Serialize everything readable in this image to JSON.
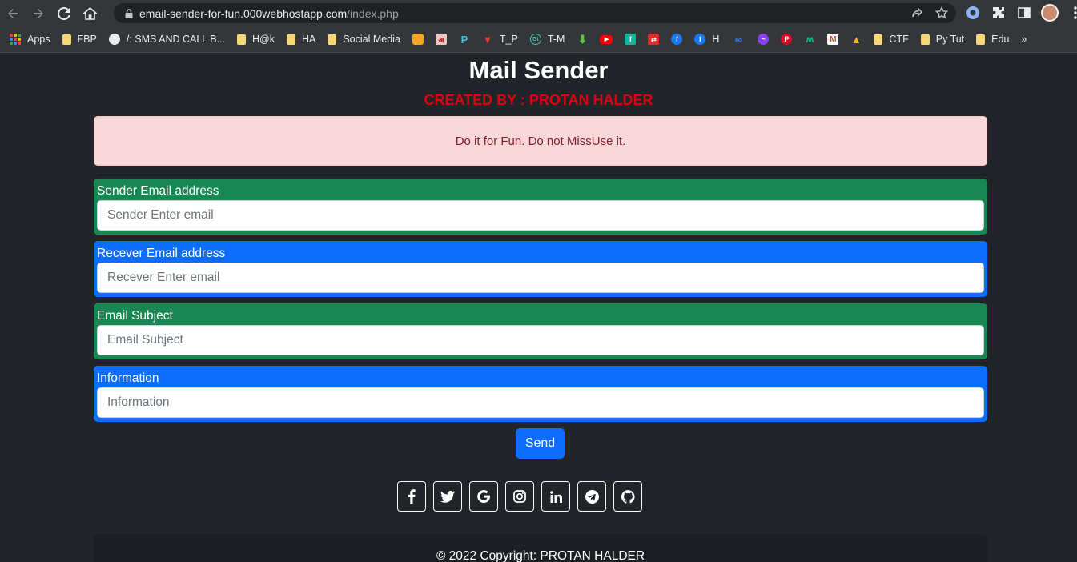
{
  "browser": {
    "url_host": "email-sender-for-fun.000webhostapp.com",
    "url_path": "/index.php",
    "icons": [
      "back-icon",
      "forward-icon",
      "reload-icon",
      "home-icon",
      "lock-icon",
      "share-icon",
      "star-icon",
      "extension-icon",
      "puzzle-icon",
      "sidebar-icon",
      "menu-icon"
    ]
  },
  "bookmarks": {
    "items": [
      {
        "label": "Apps"
      },
      {
        "label": "FBP"
      },
      {
        "label": "/: SMS AND CALL B..."
      },
      {
        "label": "H@k"
      },
      {
        "label": "HA"
      },
      {
        "label": "Social Media"
      },
      {
        "label": "T_P"
      },
      {
        "label": "T-M"
      },
      {
        "label": "H"
      },
      {
        "label": "CTF"
      },
      {
        "label": "Py Tut"
      },
      {
        "label": "Edu"
      }
    ],
    "overflow": "»"
  },
  "page": {
    "title": "Mail Sender",
    "subtitle": "CREATED BY : PROTAN HALDER",
    "alert": "Do it for Fun. Do not MissUse it."
  },
  "form": {
    "sender": {
      "label": "Sender Email address",
      "placeholder": "Sender Enter email",
      "value": ""
    },
    "receiver": {
      "label": "Recever Email address",
      "placeholder": "Recever Enter email",
      "value": ""
    },
    "subject": {
      "label": "Email Subject",
      "placeholder": "Email Subject",
      "value": ""
    },
    "information": {
      "label": "Information",
      "placeholder": "Information",
      "value": ""
    },
    "send_label": "Send"
  },
  "colors": {
    "background": "#212529",
    "subtitle": "#e0000f",
    "alert_bg": "#f8d7da",
    "alert_text": "#842029",
    "green": "#198754",
    "blue": "#0d6efd"
  },
  "socials": [
    "facebook-icon",
    "twitter-icon",
    "google-icon",
    "instagram-icon",
    "linkedin-icon",
    "telegram-icon",
    "github-icon"
  ],
  "footer": {
    "text": "© 2022 Copyright: PROTAN HALDER"
  }
}
